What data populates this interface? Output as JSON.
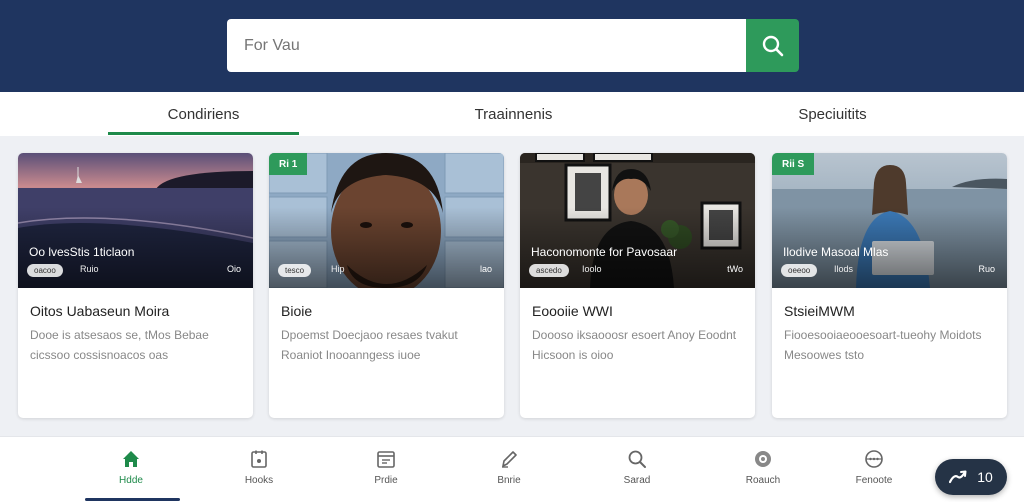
{
  "search": {
    "placeholder": "For Vau",
    "value": ""
  },
  "tabs": [
    {
      "label": "Condiriens",
      "active": true
    },
    {
      "label": "Traainnenis",
      "active": false
    },
    {
      "label": "Speciuitits",
      "active": false
    }
  ],
  "cards": [
    {
      "tag": "",
      "thumb_title": "Oo lvesStis 1ticlaon",
      "pill": "oacoo",
      "meta": "Ruio",
      "duration": "Oio",
      "title": "Oitos Uabaseun Moira",
      "description": "Dooe is atsesaos se, tMos Bebae cicssoo cossisnoacos oas"
    },
    {
      "tag": "Ri 1",
      "thumb_title": "",
      "pill": "tesco",
      "meta": "Hip",
      "duration": "lao",
      "title": "Bioie",
      "description": "Dpoemst Doecjaoo resaes tvakut Roaniot Inooanngess iuoe"
    },
    {
      "tag": "",
      "thumb_title": "Haconomonte for Pavosaar",
      "pill": "ascedo",
      "meta": "Ioolo",
      "duration": "tWo",
      "title": "Eoooiie WWI",
      "description": "Doooso iksaooosr esoert Anoy Eoodnt Hicsoon is oioo"
    },
    {
      "tag": "Rii S",
      "thumb_title": "Ilodive Masoal Mlas",
      "pill": "oeeoo",
      "meta": "Ilods",
      "duration": "Ruo",
      "title": "StsieiMWM",
      "description": "Fiooesooiaeooesoart-tueohy Moidots Mesoowes tsto"
    }
  ],
  "bottom_nav": [
    {
      "label": "Hdde",
      "icon": "home-icon",
      "active": true
    },
    {
      "label": "Hooks",
      "icon": "book-icon",
      "active": false
    },
    {
      "label": "Prdie",
      "icon": "calendar-icon",
      "active": false
    },
    {
      "label": "Bnrie",
      "icon": "pencil-icon",
      "active": false
    },
    {
      "label": "Sarad",
      "icon": "search-icon",
      "active": false
    },
    {
      "label": "Roauch",
      "icon": "gear-icon",
      "active": false
    },
    {
      "label": "Fenoote",
      "icon": "globe-icon",
      "active": false
    }
  ],
  "fab": {
    "label": "10",
    "icon": "trend-icon"
  },
  "colors": {
    "header": "#1f3560",
    "accent": "#2e9a5b",
    "active_tab": "#1e8a4a"
  }
}
